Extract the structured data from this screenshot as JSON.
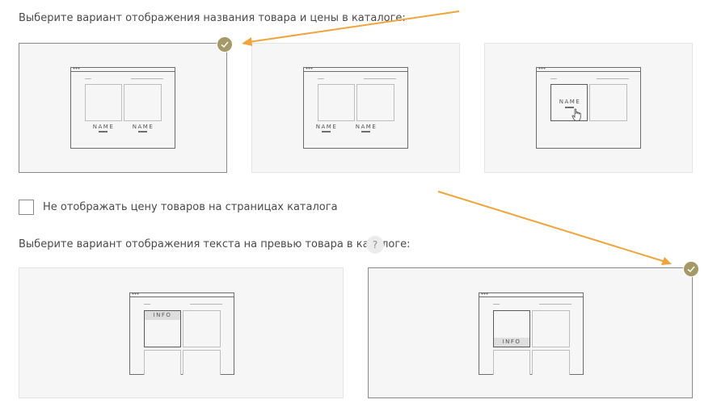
{
  "section1": {
    "title": "Выберите вариант отображения названия товара и цены в каталоге:",
    "options": [
      {
        "caption_left": "NAME",
        "caption_right": "NAME",
        "selected": true
      },
      {
        "caption_left": "NAME",
        "caption_right": "NAME",
        "selected": false
      },
      {
        "caption_left": "NAME",
        "selected": false
      }
    ]
  },
  "hide_price": {
    "label": "Не отображать цену товаров на страницах каталога",
    "checked": false
  },
  "section2": {
    "title": "Выберите вариант отображения текста на превью товара в каталоге:",
    "help_label": "?",
    "options": [
      {
        "caption": "INFO",
        "selected": false
      },
      {
        "caption": "INFO",
        "selected": true
      }
    ]
  },
  "colors": {
    "accent": "#a59a67",
    "arrow": "#f0a43c"
  },
  "icons": {
    "selected": "check-icon",
    "pointer": "hand-cursor-icon"
  }
}
